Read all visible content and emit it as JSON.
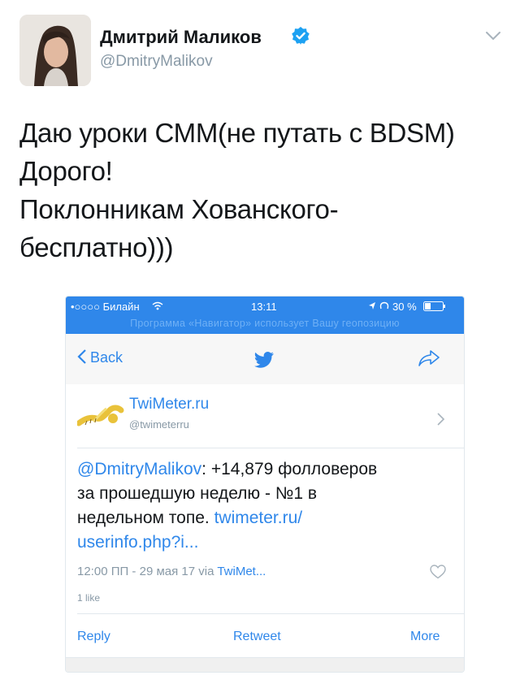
{
  "tweet": {
    "author_name": "Дмитрий Маликов",
    "author_handle": "@DmitryMalikov",
    "text_lines": [
      "Даю уроки СММ(не путать с BDSM)",
      "Дорого!",
      "Поклонникам Хованского-",
      "бесплатно)))"
    ]
  },
  "screenshot": {
    "status_bar": {
      "carrier": "•○○○○ Билайн",
      "time": "13:11",
      "battery": "30 %",
      "notice": "Программа «Навигатор» использует Вашу геопозицию"
    },
    "navbar": {
      "back_label": "Back"
    },
    "card": {
      "account_name": "TwiMeter.ru",
      "account_handle": "@twimeterru",
      "mention": "@DmitryMalikov",
      "text_line1_rest": ": +14,879 фолловеров",
      "text_line2": "за прошедшую неделю - №1 в",
      "text_line3_plain": "недельном топе. ",
      "text_line3_link": "twimeter.ru/",
      "text_line4_link": "userinfo.php?i...",
      "meta_prefix": "12:00 ПП - 29 мая 17 via ",
      "meta_source": "TwiMet...",
      "likes": "1 like",
      "actions": {
        "reply": "Reply",
        "retweet": "Retweet",
        "more": "More"
      }
    }
  },
  "colors": {
    "twitter_blue": "#2f87ea",
    "verified_blue": "#1da1f2",
    "muted_gray": "#8899a6"
  }
}
